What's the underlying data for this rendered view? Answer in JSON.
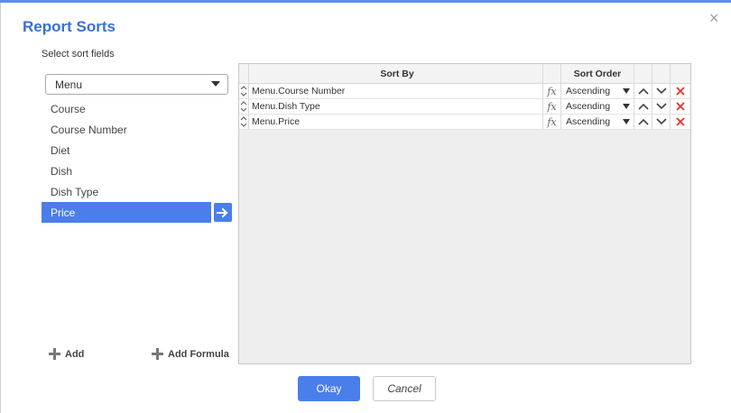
{
  "dialog": {
    "title": "Report Sorts",
    "close_glyph": "×",
    "subtitle": "Select sort fields"
  },
  "source_select": {
    "value": "Menu"
  },
  "fields": [
    "Course",
    "Course Number",
    "Diet",
    "Dish",
    "Dish Type",
    "Price"
  ],
  "selected_field": "Price",
  "bottom": {
    "add_label": "Add",
    "add_formula_label": "Add Formula"
  },
  "grid": {
    "columns": {
      "sort_by": "Sort By",
      "sort_order": "Sort Order"
    },
    "rows": [
      {
        "sort_by": "Menu.Course Number",
        "fx": "fx",
        "order": "Ascending"
      },
      {
        "sort_by": "Menu.Dish Type",
        "fx": "fx",
        "order": "Ascending"
      },
      {
        "sort_by": "Menu.Price",
        "fx": "fx",
        "order": "Ascending"
      }
    ]
  },
  "footer": {
    "okay_label": "Okay",
    "cancel_label": "Cancel"
  },
  "colors": {
    "accent": "#4a7eea",
    "title": "#3a6fd8",
    "delete": "#e0342f"
  },
  "icons": [
    "close-icon",
    "chevron-down-icon",
    "arrow-right-icon",
    "plus-icon",
    "drag-handle-icon",
    "formula-icon",
    "move-up-icon",
    "move-down-icon",
    "delete-icon"
  ]
}
